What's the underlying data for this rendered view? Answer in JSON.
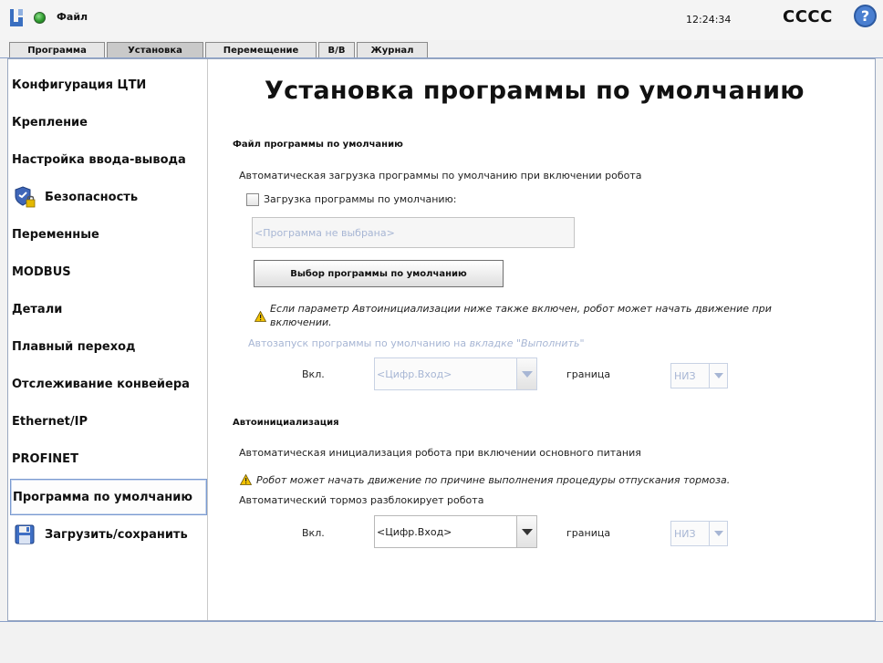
{
  "topbar": {
    "file_label": "Файл",
    "time": "12:24:34",
    "robot_name": "CCCC",
    "help_label": "?"
  },
  "tabs": [
    {
      "label": "Программа",
      "active": false
    },
    {
      "label": "Установка",
      "active": true
    },
    {
      "label": "Перемещение",
      "active": false
    },
    {
      "label": "В/В",
      "active": false
    },
    {
      "label": "Журнал",
      "active": false
    }
  ],
  "sidebar": {
    "items": [
      {
        "label": "Конфигурация ЦТИ"
      },
      {
        "label": "Крепление"
      },
      {
        "label": "Настройка ввода-вывода"
      },
      {
        "label": "Безопасность",
        "icon": "safety-shield-lock-icon"
      },
      {
        "label": "Переменные"
      },
      {
        "label": "MODBUS"
      },
      {
        "label": "Детали"
      },
      {
        "label": "Плавный переход"
      },
      {
        "label": "Отслеживание конвейера"
      },
      {
        "label": "Ethernet/IP"
      },
      {
        "label": "PROFINET"
      },
      {
        "label": "Программа по умолчанию",
        "selected": true
      },
      {
        "label": "Загрузить/сохранить",
        "icon": "floppy-disk-icon"
      }
    ]
  },
  "main": {
    "title": "Установка программы по умолчанию",
    "default_file": {
      "heading": "Файл программы по умолчанию",
      "description": "Автоматическая загрузка программы по умолчанию при включении робота",
      "checkbox_label": "Загрузка программы по умолчанию:",
      "checkbox_checked": false,
      "program_placeholder": "<Программа не выбрана>",
      "select_button": "Выбор программы по умолчанию",
      "warning_line1": "Если параметр Автоинициализации ниже также включен, робот может начать движение при",
      "warning_line2": "включении.",
      "autostart_text": "Автозапуск программы по умолчанию на",
      "autostart_link": "вкладке \"Выполнить\"",
      "on_label": "Вкл.",
      "input_value": "<Цифр.Вход>",
      "edge_label": "граница",
      "edge_value": "НИЗ"
    },
    "autoinit": {
      "heading": "Автоинициализация",
      "description": "Автоматическая инициализация робота при включении основного питания",
      "warning": "Робот может начать движение по причине выполнения процедуры отпускания тормоза.",
      "brake_text": "Автоматический тормоз разблокирует робота",
      "on_label": "Вкл.",
      "input_value": "<Цифр.Вход>",
      "edge_label": "граница",
      "edge_value": "НИЗ"
    }
  },
  "colors": {
    "accent_border": "#7a9ad0",
    "disabled_text": "#a7b6d4",
    "warning_yellow": "#f2c200",
    "help_blue": "#4a7fd0",
    "status_green": "#2e9a2e"
  }
}
